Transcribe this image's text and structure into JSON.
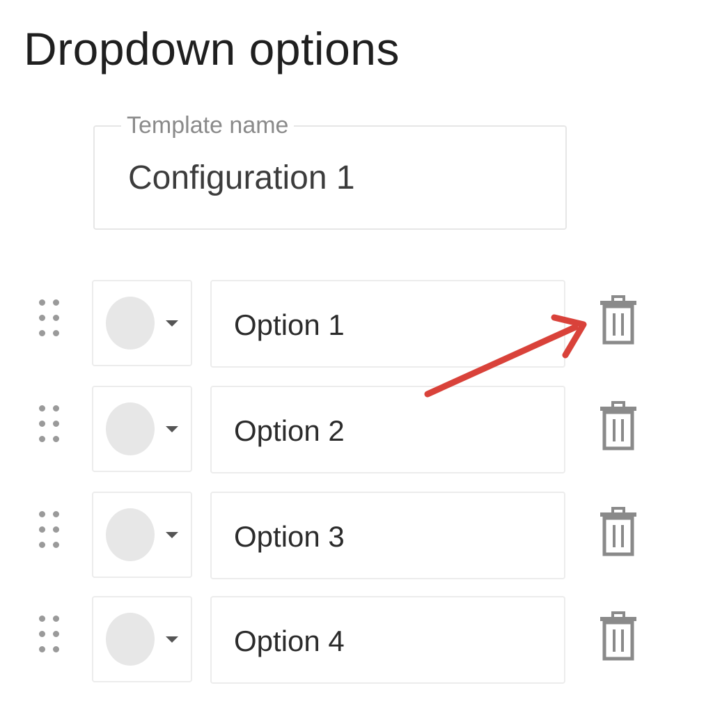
{
  "page": {
    "title": "Dropdown options"
  },
  "template": {
    "label": "Template name",
    "value": "Configuration 1"
  },
  "options": [
    {
      "label": "Option 1",
      "swatch_color": "#e7e7e7"
    },
    {
      "label": "Option 2",
      "swatch_color": "#e7e7e7"
    },
    {
      "label": "Option 3",
      "swatch_color": "#e7e7e7"
    },
    {
      "label": "Option 4",
      "swatch_color": "#e7e7e7"
    }
  ],
  "icons": {
    "drag": "drag-handle-icon",
    "caret": "caret-down-icon",
    "delete": "trash-icon",
    "annotation": "arrow-icon"
  },
  "colors": {
    "annotation_arrow": "#d9423a",
    "icon_gray": "#8a8a8a"
  }
}
